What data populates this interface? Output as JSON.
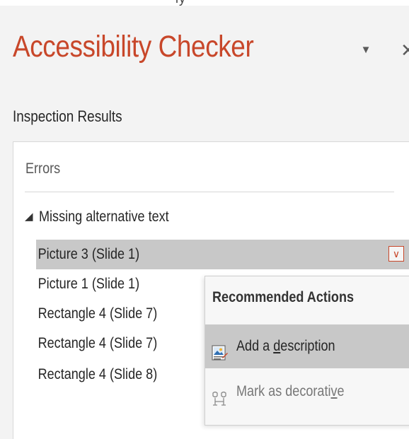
{
  "pane": {
    "title": "Accessibility Checker",
    "dropdown_glyph": "▼",
    "close_glyph": "✕",
    "title_color": "#c8472a"
  },
  "inspection": {
    "label": "Inspection Results",
    "errors_label": "Errors",
    "group": {
      "expand_glyph": "◢",
      "label": "Missing alternative text",
      "items": [
        {
          "label": "Picture 3  (Slide 1)",
          "selected": true
        },
        {
          "label": "Picture 1  (Slide 1)",
          "selected": false
        },
        {
          "label": "Rectangle 4  (Slide 7)",
          "selected": false
        },
        {
          "label": "Rectangle 4  (Slide 7)",
          "selected": false
        },
        {
          "label": "Rectangle 4  (Slide 8)",
          "selected": false
        }
      ]
    },
    "item_dropdown_glyph": "∨"
  },
  "recommended_actions": {
    "header": "Recommended Actions",
    "items": [
      {
        "pre": "Add a ",
        "accel": "d",
        "post": "escription",
        "icon": "picture-description-icon",
        "highlighted": true
      },
      {
        "pre": "Mark as decorati",
        "accel": "v",
        "post": "e",
        "icon": "mark-decorative-icon",
        "highlighted": false
      }
    ]
  },
  "icons": {
    "dropdown": "dropdown-arrow-icon",
    "close": "close-icon",
    "expand": "expand-triangle-icon"
  }
}
